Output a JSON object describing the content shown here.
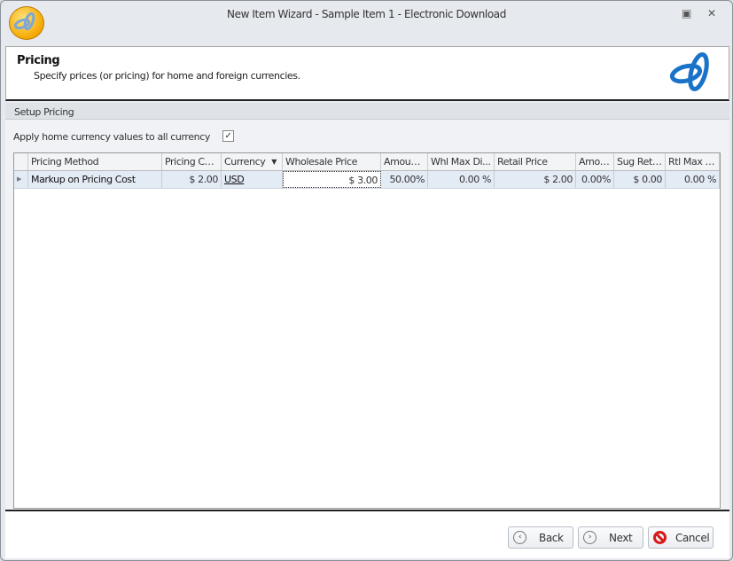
{
  "window": {
    "title": "New Item Wizard - Sample Item 1 - Electronic Download"
  },
  "header": {
    "title": "Pricing",
    "subtitle": "Specify prices (or pricing) for home and foreign currencies."
  },
  "section": {
    "title": "Setup Pricing"
  },
  "apply": {
    "label": "Apply home currency values to all currency",
    "checked": true,
    "mark": "✓"
  },
  "grid": {
    "columns": [
      "Pricing Method",
      "Pricing Cost",
      "Currency",
      "Wholesale Price",
      "Amount ...",
      "Whl Max Di...",
      "Retail Price",
      "Amou...",
      "Sug Reta...",
      "Rtl Max D..."
    ],
    "rows": [
      [
        "Markup on Pricing Cost",
        "$ 2.00",
        "USD",
        "$ 3.00",
        "50.00%",
        "0.00 %",
        "$ 2.00",
        "0.00%",
        "$ 0.00",
        "0.00 %"
      ]
    ]
  },
  "buttons": {
    "back": "Back",
    "next": "Next",
    "cancel": "Cancel"
  }
}
